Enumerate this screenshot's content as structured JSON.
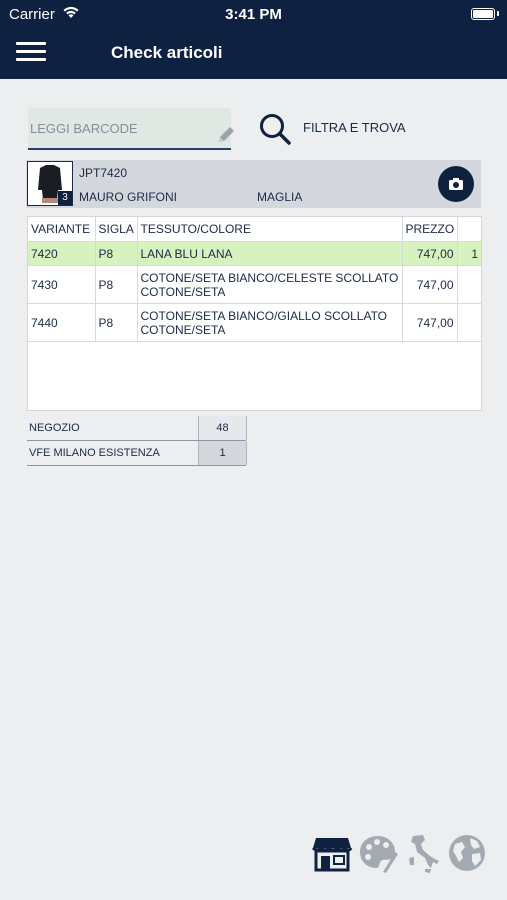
{
  "status_bar": {
    "carrier": "Carrier",
    "time": "3:41 PM"
  },
  "header": {
    "title": "Check articoli",
    "menu_icon": "hamburger-menu-icon"
  },
  "search": {
    "placeholder": "LEGGI BARCODE",
    "value": "",
    "filter_label": "FILTRA E TROVA"
  },
  "article": {
    "code": "JPT7420",
    "brand": "MAURO GRIFONI",
    "type": "MAGLIA",
    "thumbnail_count": "3"
  },
  "variants": {
    "headers": [
      "VARIANTE",
      "SIGLA",
      "TESSUTO/COLORE",
      "PREZZO",
      ""
    ],
    "rows": [
      {
        "variante": "7420",
        "sigla": "P8",
        "tessuto": "LANA BLU LANA",
        "prezzo": "747,00",
        "count": "1",
        "selected": true
      },
      {
        "variante": "7430",
        "sigla": "P8",
        "tessuto": "COTONE/SETA BIANCO/CELESTE SCOLLATO COTONE/SETA",
        "prezzo": "747,00",
        "count": "",
        "selected": false
      },
      {
        "variante": "7440",
        "sigla": "P8",
        "tessuto": "COTONE/SETA BIANCO/GIALLO SCOLLATO COTONE/SETA",
        "prezzo": "747,00",
        "count": "",
        "selected": false
      }
    ]
  },
  "stock": [
    {
      "label": "NEGOZIO",
      "value": "48"
    },
    {
      "label": "VFE MILANO ESISTENZA",
      "value": "1"
    }
  ],
  "bottom_nav": [
    "store-icon",
    "palette-icon",
    "italy-map-icon",
    "globe-icon"
  ],
  "colors": {
    "primary": "#0e2140",
    "selected_row": "#d7f2bf",
    "background": "#eceef0"
  }
}
